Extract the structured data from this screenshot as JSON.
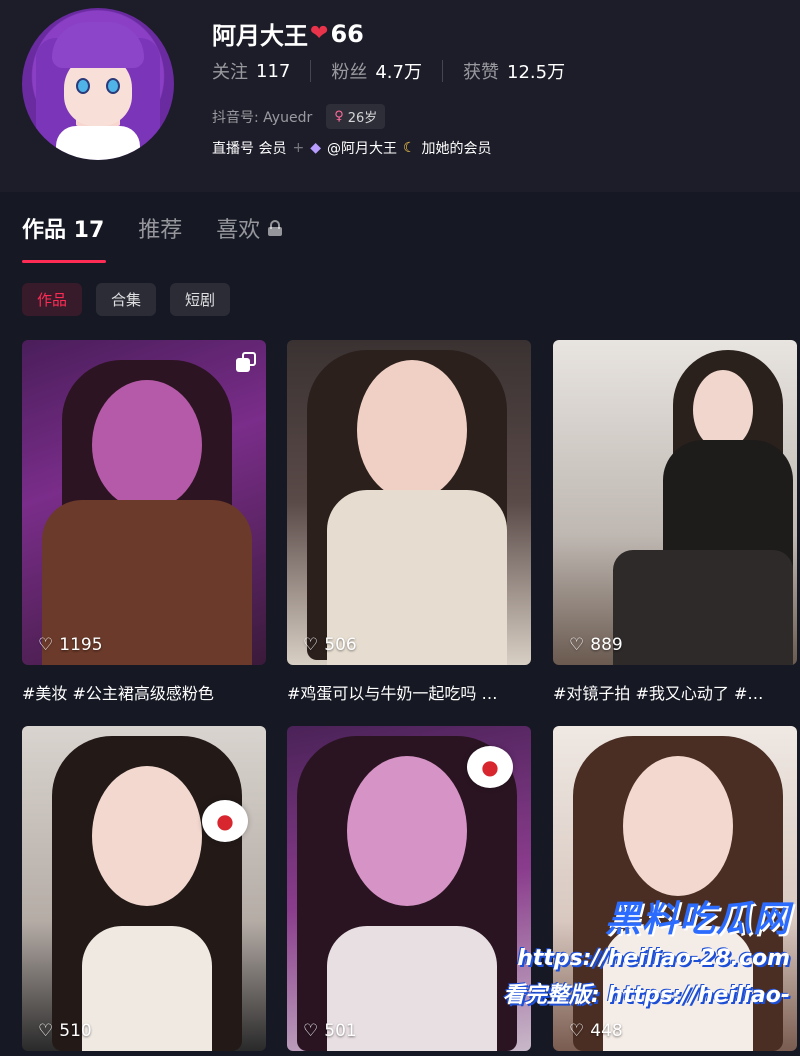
{
  "profile": {
    "name": "阿月大王",
    "name_suffix": "66",
    "stats": [
      {
        "label": "关注",
        "value": "117"
      },
      {
        "label": "粉丝",
        "value": "4.7万"
      },
      {
        "label": "获赞",
        "value": "12.5万"
      }
    ],
    "douyin_id": "抖音号: Ayuedr",
    "age_badge": "26岁",
    "member": {
      "prefix": "直播号 会员",
      "handle": "@阿月大王",
      "suffix": "加她的会员"
    }
  },
  "tabs": [
    {
      "label": "作品 17",
      "active": true
    },
    {
      "label": "推荐",
      "active": false
    },
    {
      "label": "喜欢",
      "active": false,
      "locked": true
    }
  ],
  "chips": [
    {
      "label": "作品",
      "active": true
    },
    {
      "label": "合集",
      "active": false
    },
    {
      "label": "短剧",
      "active": false
    }
  ],
  "videos": [
    {
      "likes": "1195",
      "caption": "#美妆 #公主裙高级感粉色",
      "multi": true
    },
    {
      "likes": "506",
      "caption": "#鸡蛋可以与牛奶一起吃吗 …"
    },
    {
      "likes": "889",
      "caption": "#对镜子拍 #我又心动了 #…"
    },
    {
      "likes": "510"
    },
    {
      "likes": "501"
    },
    {
      "likes": "448"
    }
  ],
  "watermark": {
    "title": "黑料吃瓜网",
    "url": "https://heiliao-28.com",
    "line2": "看完整版: https://heiliao-"
  },
  "colors": {
    "accent": "#fe2c55",
    "background": "#161823"
  }
}
